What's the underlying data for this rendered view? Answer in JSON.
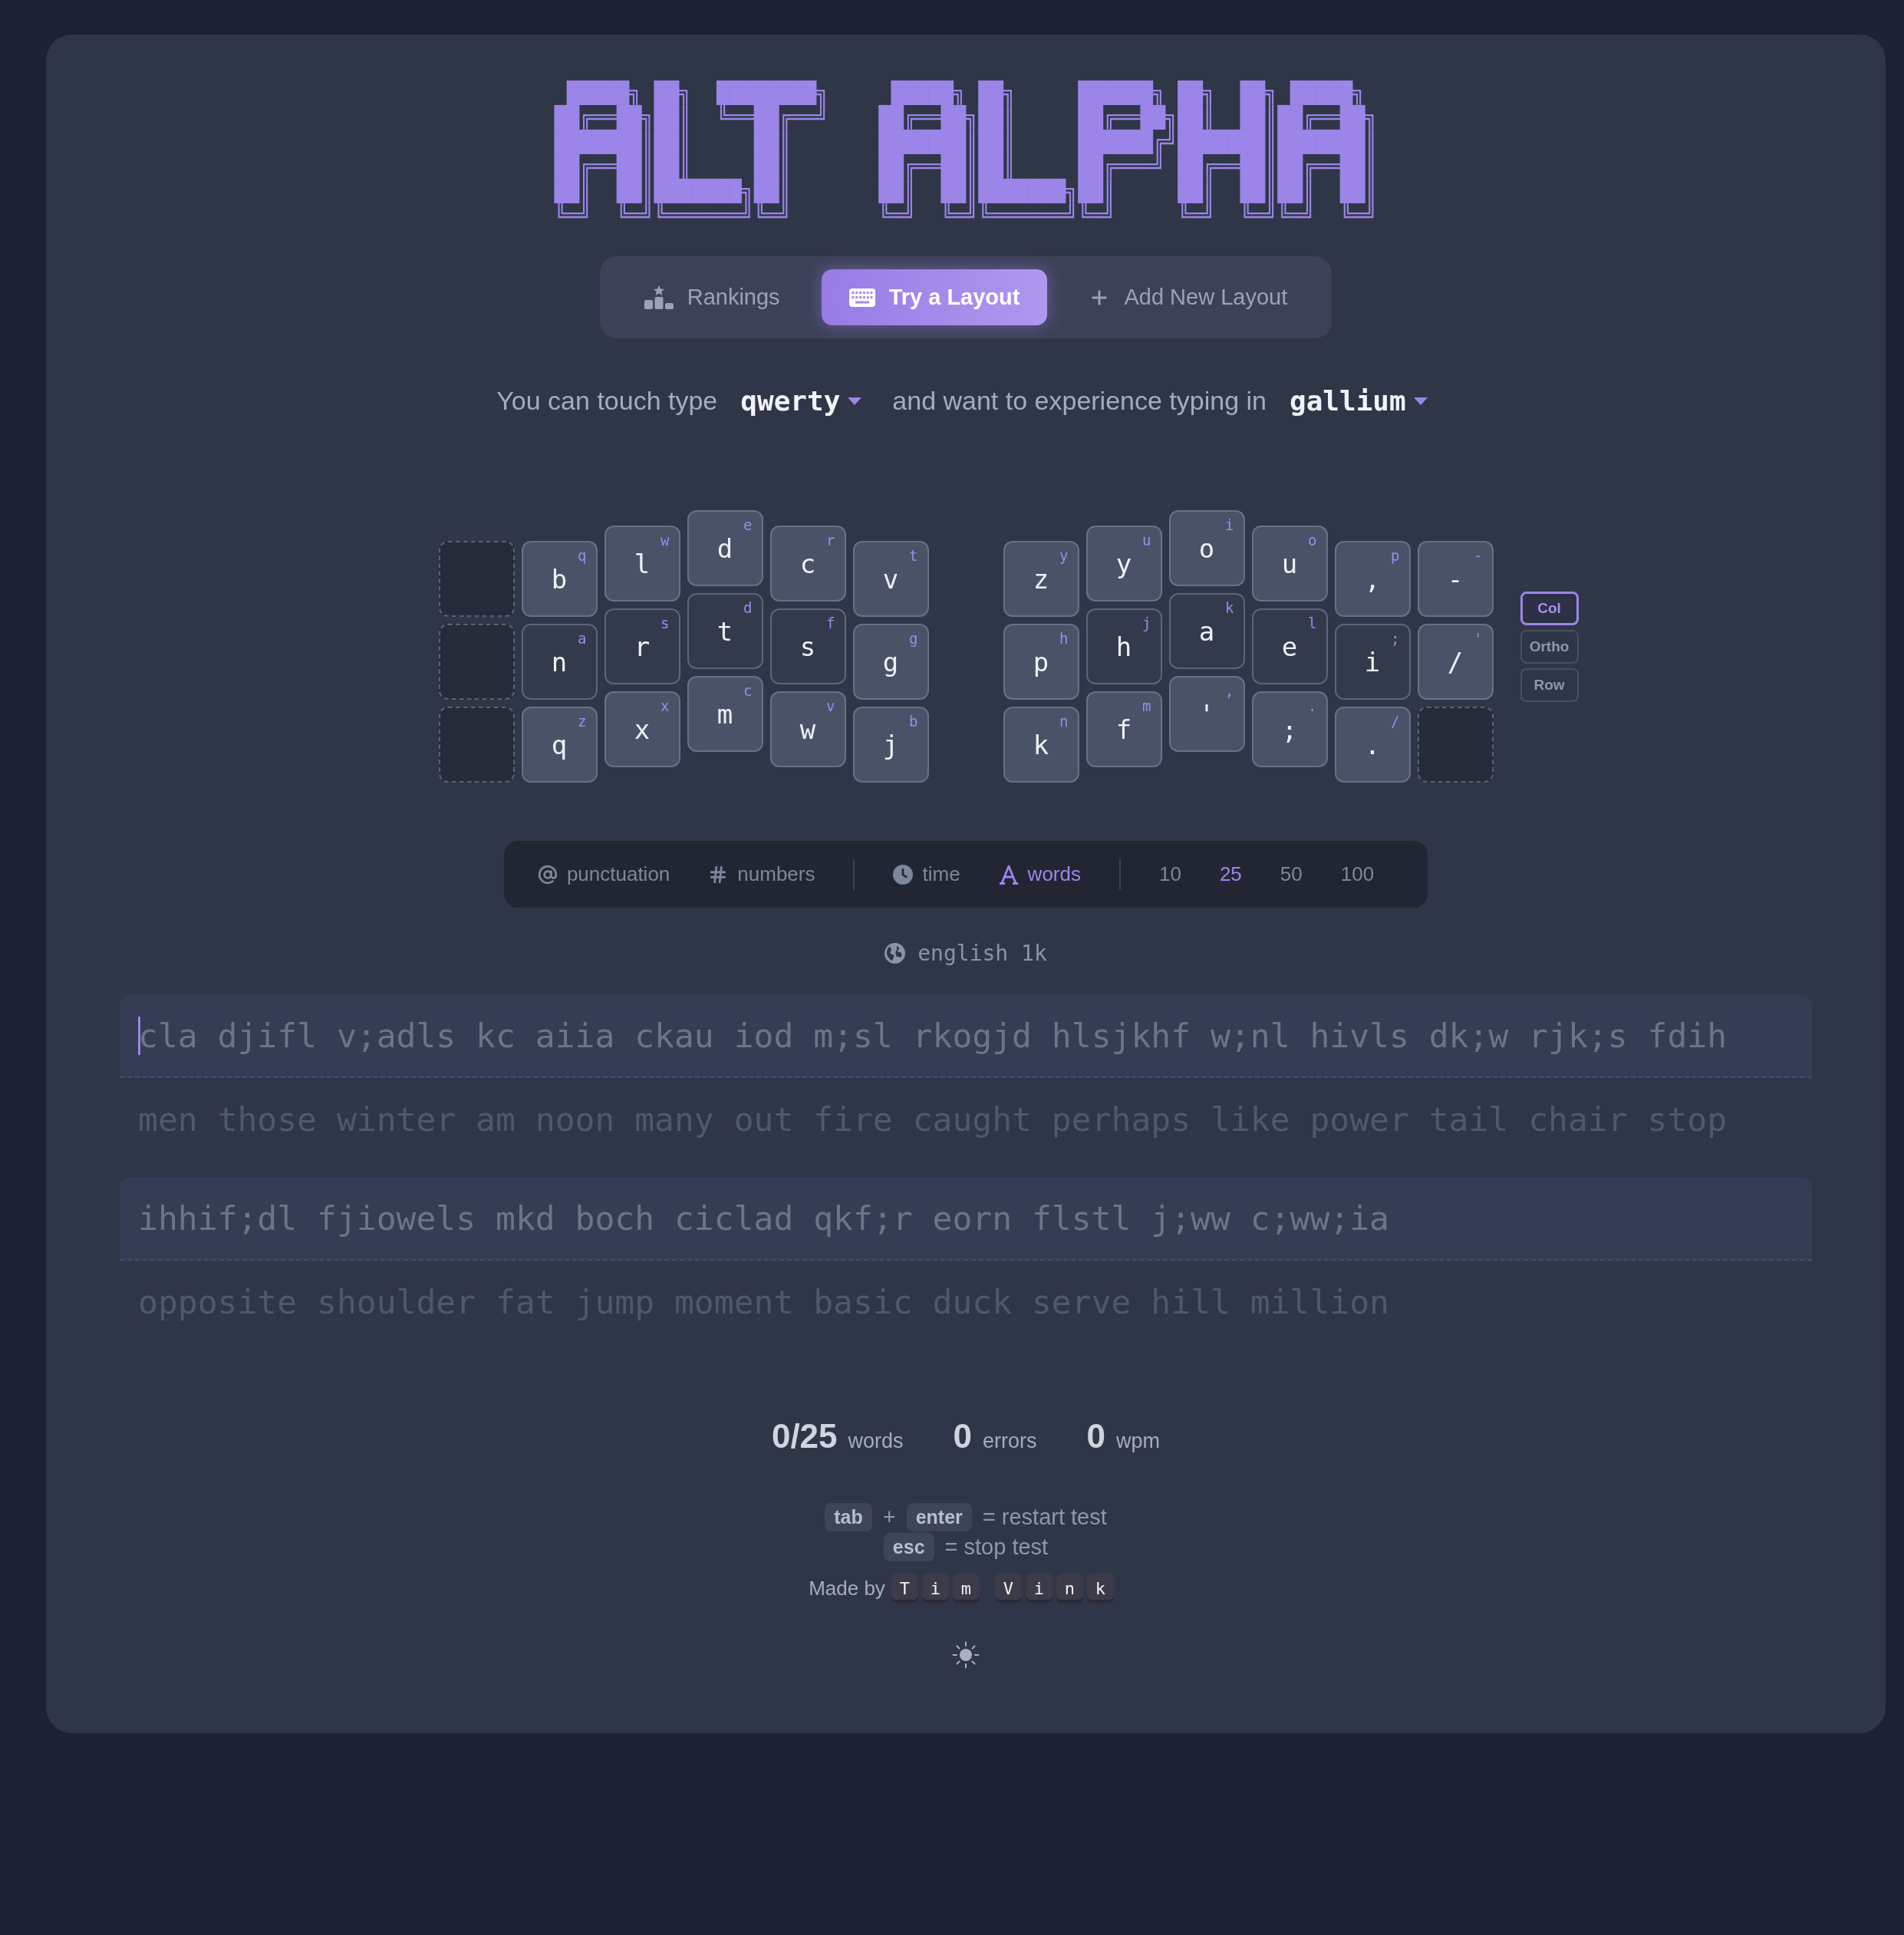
{
  "logo": {
    "lines": [
      " █████╗ ██╗  ████████╗     █████╗ ██╗     ██████╗ ██╗  ██╗ █████╗",
      "██╔══██╗██║  ╚══██╔══╝    ██╔══██╗██║     ██╔══██╗██║  ██║██╔══██╗",
      "███████║██║     ██║       ███████║██║     ██████╔╝███████║███████║",
      "██╔══██║██║     ██║       ██╔══██║██║     ██╔═══╝ ██╔══██║██╔══██║",
      "██║  ██║███████╗██║       ██║  ██║███████╗██║     ██║  ██║██║  ██║",
      "╚═╝  ╚═╝╚══════╝╚═╝       ╚═╝  ╚═╝╚══════╝╚═╝     ╚═╝  ╚═╝╚═╝  ╚═╝"
    ]
  },
  "nav": {
    "tabs": [
      {
        "kind": "podium",
        "label": "Rankings",
        "selected": false
      },
      {
        "kind": "keyboard",
        "label": "Try a Layout",
        "selected": true
      },
      {
        "kind": "plus",
        "label": "Add New Layout",
        "selected": false
      }
    ]
  },
  "layout_choice": {
    "lead": "You can touch type",
    "known_layout": "qwerty",
    "middle": "and want to experience typing in",
    "target_layout": "gallium"
  },
  "keyboard": {
    "halves": [
      {
        "columns": [
          {
            "keys": [
              {
                "kind": "empty"
              },
              {
                "kind": "empty"
              },
              {
                "kind": "empty"
              }
            ]
          },
          {
            "keys": [
              {
                "kind": "key",
                "char": "b",
                "hint": "q",
                "home": false
              },
              {
                "kind": "key",
                "char": "n",
                "hint": "a",
                "home": true
              },
              {
                "kind": "key",
                "char": "q",
                "hint": "z",
                "home": false
              }
            ]
          },
          {
            "keys": [
              {
                "kind": "key",
                "char": "l",
                "hint": "w",
                "home": false
              },
              {
                "kind": "key",
                "char": "r",
                "hint": "s",
                "home": true
              },
              {
                "kind": "key",
                "char": "x",
                "hint": "x",
                "home": false
              }
            ]
          },
          {
            "keys": [
              {
                "kind": "key",
                "char": "d",
                "hint": "e",
                "home": false
              },
              {
                "kind": "key",
                "char": "t",
                "hint": "d",
                "home": true
              },
              {
                "kind": "key",
                "char": "m",
                "hint": "c",
                "home": false
              }
            ]
          },
          {
            "keys": [
              {
                "kind": "key",
                "char": "c",
                "hint": "r",
                "home": false
              },
              {
                "kind": "key",
                "char": "s",
                "hint": "f",
                "home": true
              },
              {
                "kind": "key",
                "char": "w",
                "hint": "v",
                "home": false
              }
            ]
          },
          {
            "keys": [
              {
                "kind": "key",
                "char": "v",
                "hint": "t",
                "home": false
              },
              {
                "kind": "key",
                "char": "g",
                "hint": "g",
                "home": false
              },
              {
                "kind": "key",
                "char": "j",
                "hint": "b",
                "home": false
              }
            ]
          }
        ]
      },
      {
        "columns": [
          {
            "keys": [
              {
                "kind": "key",
                "char": "z",
                "hint": "y",
                "home": false
              },
              {
                "kind": "key",
                "char": "p",
                "hint": "h",
                "home": false
              },
              {
                "kind": "key",
                "char": "k",
                "hint": "n",
                "home": false
              }
            ]
          },
          {
            "keys": [
              {
                "kind": "key",
                "char": "y",
                "hint": "u",
                "home": false
              },
              {
                "kind": "key",
                "char": "h",
                "hint": "j",
                "home": true
              },
              {
                "kind": "key",
                "char": "f",
                "hint": "m",
                "home": false
              }
            ]
          },
          {
            "keys": [
              {
                "kind": "key",
                "char": "o",
                "hint": "i",
                "home": false
              },
              {
                "kind": "key",
                "char": "a",
                "hint": "k",
                "home": true
              },
              {
                "kind": "key",
                "char": "'",
                "hint": ",",
                "home": false
              }
            ]
          },
          {
            "keys": [
              {
                "kind": "key",
                "char": "u",
                "hint": "o",
                "home": false
              },
              {
                "kind": "key",
                "char": "e",
                "hint": "l",
                "home": true
              },
              {
                "kind": "key",
                "char": ";",
                "hint": ".",
                "home": false
              }
            ]
          },
          {
            "keys": [
              {
                "kind": "key",
                "char": ",",
                "hint": "p",
                "home": false
              },
              {
                "kind": "key",
                "char": "i",
                "hint": ";",
                "home": true
              },
              {
                "kind": "key",
                "char": ".",
                "hint": "/",
                "home": false
              }
            ]
          },
          {
            "keys": [
              {
                "kind": "key",
                "char": "-",
                "hint": "-",
                "home": false
              },
              {
                "kind": "key",
                "char": "/",
                "hint": "'",
                "home": false
              },
              {
                "kind": "empty"
              }
            ]
          }
        ]
      }
    ],
    "geometries": [
      {
        "label": "Col",
        "selected": true
      },
      {
        "label": "Ortho",
        "selected": false
      },
      {
        "label": "Row",
        "selected": false
      }
    ]
  },
  "test_options": {
    "toggles": [
      {
        "kind": "at",
        "label": "punctuation",
        "on": false
      },
      {
        "kind": "hash",
        "label": "numbers",
        "on": false
      }
    ],
    "modes": [
      {
        "kind": "clock",
        "label": "time",
        "selected": false
      },
      {
        "kind": "font",
        "label": "words",
        "selected": true
      }
    ],
    "counts": [
      {
        "label": "10",
        "selected": false
      },
      {
        "label": "25",
        "selected": true
      },
      {
        "label": "50",
        "selected": false
      },
      {
        "label": "100",
        "selected": false
      }
    ]
  },
  "word_list": {
    "label": "english 1k"
  },
  "test": {
    "groups": [
      {
        "typed": "cla djifl v;adls kc aiia ckau iod m;sl rkogjd hlsjkhf w;nl hivls dk;w rjk;s fdih",
        "words": "men those winter am noon many out fire caught perhaps like power tail chair stop",
        "caret": true
      },
      {
        "typed": "ihhif;dl fjiowels mkd boch ciclad qkf;r eorn flstl j;ww c;ww;ia",
        "words": "opposite shoulder fat jump moment basic duck serve hill million",
        "caret": false
      }
    ]
  },
  "stats": [
    {
      "value": "0/25",
      "label": "words"
    },
    {
      "value": "0",
      "label": "errors"
    },
    {
      "value": "0",
      "label": "wpm"
    }
  ],
  "shortcuts": [
    {
      "keys": [
        "tab",
        "enter"
      ],
      "joiner": "+",
      "action": "= restart test"
    },
    {
      "keys": [
        "esc"
      ],
      "action": "= stop test"
    }
  ],
  "credit": {
    "lead": "Made by",
    "names": [
      {
        "letters": [
          "T",
          "i",
          "m"
        ]
      },
      {
        "letters": [
          "V",
          "i",
          "n",
          "k"
        ]
      }
    ]
  }
}
